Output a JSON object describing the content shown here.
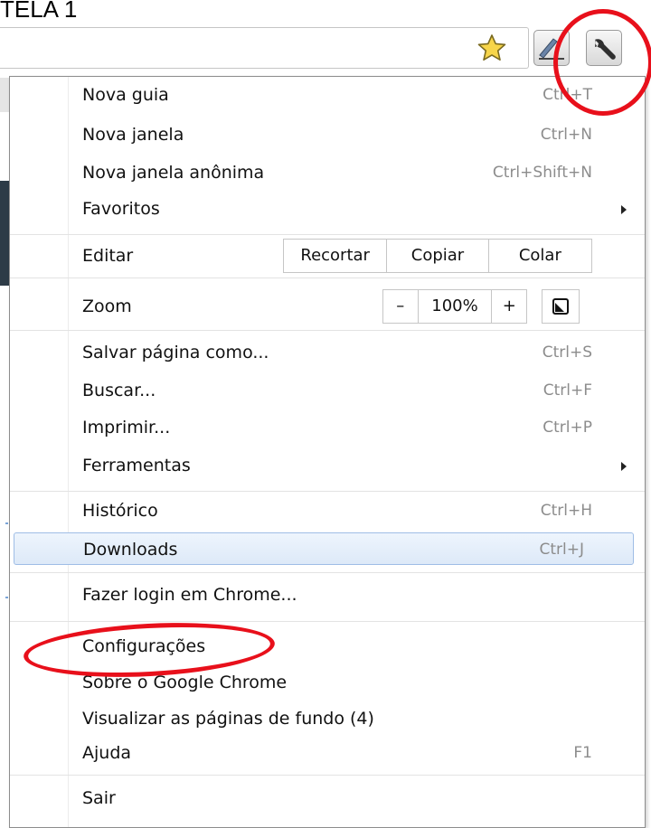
{
  "caption": "TELA 1",
  "toolbar": {
    "bookmark_icon": "star-icon",
    "page_icon": "pen-icon",
    "menu_icon": "wrench-icon"
  },
  "menu": {
    "new_tab": {
      "label": "Nova guia",
      "shortcut": "Ctrl+T"
    },
    "new_window": {
      "label": "Nova janela",
      "shortcut": "Ctrl+N"
    },
    "incognito": {
      "label": "Nova janela anônima",
      "shortcut": "Ctrl+Shift+N"
    },
    "bookmarks": {
      "label": "Favoritos"
    },
    "edit": {
      "label": "Editar",
      "cut": "Recortar",
      "copy": "Copiar",
      "paste": "Colar"
    },
    "zoom": {
      "label": "Zoom",
      "minus": "–",
      "value": "100%",
      "plus": "+"
    },
    "save_page": {
      "label": "Salvar página como...",
      "shortcut": "Ctrl+S"
    },
    "find": {
      "label": "Buscar...",
      "shortcut": "Ctrl+F"
    },
    "print": {
      "label": "Imprimir...",
      "shortcut": "Ctrl+P"
    },
    "tools": {
      "label": "Ferramentas"
    },
    "history": {
      "label": "Histórico",
      "shortcut": "Ctrl+H"
    },
    "downloads": {
      "label": "Downloads",
      "shortcut": "Ctrl+J"
    },
    "sign_in": {
      "label": "Fazer login em Chrome..."
    },
    "settings": {
      "label": "Configurações"
    },
    "about": {
      "label": "Sobre o Google Chrome"
    },
    "background_pages": {
      "label": "Visualizar as páginas de fundo (4)"
    },
    "help": {
      "label": "Ajuda",
      "shortcut": "F1"
    },
    "exit": {
      "label": "Sair"
    }
  },
  "colors": {
    "highlight_ring": "#e8101b",
    "hover_row": "#dde9f8"
  }
}
